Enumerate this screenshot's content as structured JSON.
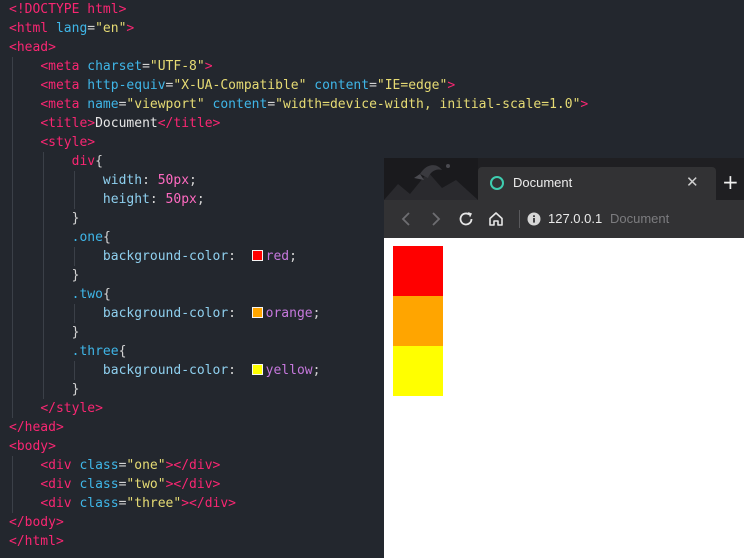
{
  "editor": {
    "lines": [
      [
        [
          "t-tag",
          "<!DOCTYPE html>"
        ]
      ],
      [
        [
          "t-tag",
          "<html"
        ],
        [
          "t-attr",
          " lang"
        ],
        [
          "t-pun",
          "="
        ],
        [
          "t-str",
          "\"en\""
        ],
        [
          "t-tag",
          ">"
        ]
      ],
      [
        [
          "t-tag",
          "<head>"
        ]
      ],
      [
        [
          "t-pun",
          "    "
        ],
        [
          "t-tag",
          "<meta"
        ],
        [
          "t-attr",
          " charset"
        ],
        [
          "t-pun",
          "="
        ],
        [
          "t-str",
          "\"UTF-8\""
        ],
        [
          "t-tag",
          ">"
        ]
      ],
      [
        [
          "t-pun",
          "    "
        ],
        [
          "t-tag",
          "<meta"
        ],
        [
          "t-attr",
          " http-equiv"
        ],
        [
          "t-pun",
          "="
        ],
        [
          "t-str",
          "\"X-UA-Compatible\""
        ],
        [
          "t-attr",
          " content"
        ],
        [
          "t-pun",
          "="
        ],
        [
          "t-str",
          "\"IE=edge\""
        ],
        [
          "t-tag",
          ">"
        ]
      ],
      [
        [
          "t-pun",
          "    "
        ],
        [
          "t-tag",
          "<meta"
        ],
        [
          "t-attr",
          " name"
        ],
        [
          "t-pun",
          "="
        ],
        [
          "t-str",
          "\"viewport\""
        ],
        [
          "t-attr",
          " content"
        ],
        [
          "t-pun",
          "="
        ],
        [
          "t-str",
          "\"width=device-width, initial-scale=1.0\""
        ],
        [
          "t-tag",
          ">"
        ]
      ],
      [
        [
          "t-pun",
          "    "
        ],
        [
          "t-tag",
          "<title>"
        ],
        [
          "t-txt",
          "Document"
        ],
        [
          "t-tag",
          "</title>"
        ]
      ],
      [
        [
          "t-pun",
          "    "
        ],
        [
          "t-tag",
          "<style>"
        ]
      ],
      [
        [
          "t-pun",
          "        "
        ],
        [
          "t-sel",
          "div"
        ],
        [
          "t-pun",
          "{"
        ]
      ],
      [
        [
          "t-pun",
          "            "
        ],
        [
          "t-prop",
          "width"
        ],
        [
          "t-pun",
          ": "
        ],
        [
          "t-num",
          "50px"
        ],
        [
          "t-pun",
          ";"
        ]
      ],
      [
        [
          "t-pun",
          "            "
        ],
        [
          "t-prop",
          "height"
        ],
        [
          "t-pun",
          ": "
        ],
        [
          "t-num",
          "50px"
        ],
        [
          "t-pun",
          ";"
        ]
      ],
      [
        [
          "t-pun",
          "        }"
        ]
      ],
      [
        [
          "t-pun",
          "        "
        ],
        [
          "t-cls",
          ".one"
        ],
        [
          "t-pun",
          "{"
        ]
      ],
      [
        [
          "t-pun",
          "            "
        ],
        [
          "t-prop",
          "background-color"
        ],
        [
          "t-pun",
          ":  "
        ],
        [
          "swatch",
          "#ff0000"
        ],
        [
          "t-val",
          "red"
        ],
        [
          "t-pun",
          ";"
        ]
      ],
      [
        [
          "t-pun",
          "        }"
        ]
      ],
      [
        [
          "t-pun",
          "        "
        ],
        [
          "t-cls",
          ".two"
        ],
        [
          "t-pun",
          "{"
        ]
      ],
      [
        [
          "t-pun",
          "            "
        ],
        [
          "t-prop",
          "background-color"
        ],
        [
          "t-pun",
          ":  "
        ],
        [
          "swatch",
          "#ffa500"
        ],
        [
          "t-val",
          "orange"
        ],
        [
          "t-pun",
          ";"
        ]
      ],
      [
        [
          "t-pun",
          "        }"
        ]
      ],
      [
        [
          "t-pun",
          "        "
        ],
        [
          "t-cls",
          ".three"
        ],
        [
          "t-pun",
          "{"
        ]
      ],
      [
        [
          "t-pun",
          "            "
        ],
        [
          "t-prop",
          "background-color"
        ],
        [
          "t-pun",
          ":  "
        ],
        [
          "swatch",
          "#ffff00"
        ],
        [
          "t-val",
          "yellow"
        ],
        [
          "t-pun",
          ";"
        ]
      ],
      [
        [
          "t-pun",
          "        }"
        ]
      ],
      [
        [
          "t-pun",
          "    "
        ],
        [
          "t-tag",
          "</style>"
        ]
      ],
      [
        [
          "t-tag",
          "</head>"
        ]
      ],
      [
        [
          "t-tag",
          "<body>"
        ]
      ],
      [
        [
          "t-pun",
          "    "
        ],
        [
          "t-tag",
          "<div"
        ],
        [
          "t-attr",
          " class"
        ],
        [
          "t-pun",
          "="
        ],
        [
          "t-str",
          "\"one\""
        ],
        [
          "t-tag",
          "></div>"
        ]
      ],
      [
        [
          "t-pun",
          "    "
        ],
        [
          "t-tag",
          "<div"
        ],
        [
          "t-attr",
          " class"
        ],
        [
          "t-pun",
          "="
        ],
        [
          "t-str",
          "\"two\""
        ],
        [
          "t-tag",
          "></div>"
        ]
      ],
      [
        [
          "t-pun",
          "    "
        ],
        [
          "t-tag",
          "<div"
        ],
        [
          "t-attr",
          " class"
        ],
        [
          "t-pun",
          "="
        ],
        [
          "t-str",
          "\"three\""
        ],
        [
          "t-tag",
          "></div>"
        ]
      ],
      [
        [
          "t-tag",
          "</body>"
        ]
      ],
      [
        [
          "t-tag",
          "</html>"
        ]
      ]
    ]
  },
  "browser": {
    "tab_title": "Document",
    "close_glyph": "✕",
    "new_tab_glyph": "+",
    "url_host": "127.0.0.1",
    "url_title": "Document",
    "accent_color": "#3ecdb0",
    "boxes": [
      {
        "class": "one",
        "color": "#ff0000"
      },
      {
        "class": "two",
        "color": "#ffa500"
      },
      {
        "class": "three",
        "color": "#ffff00"
      }
    ]
  }
}
